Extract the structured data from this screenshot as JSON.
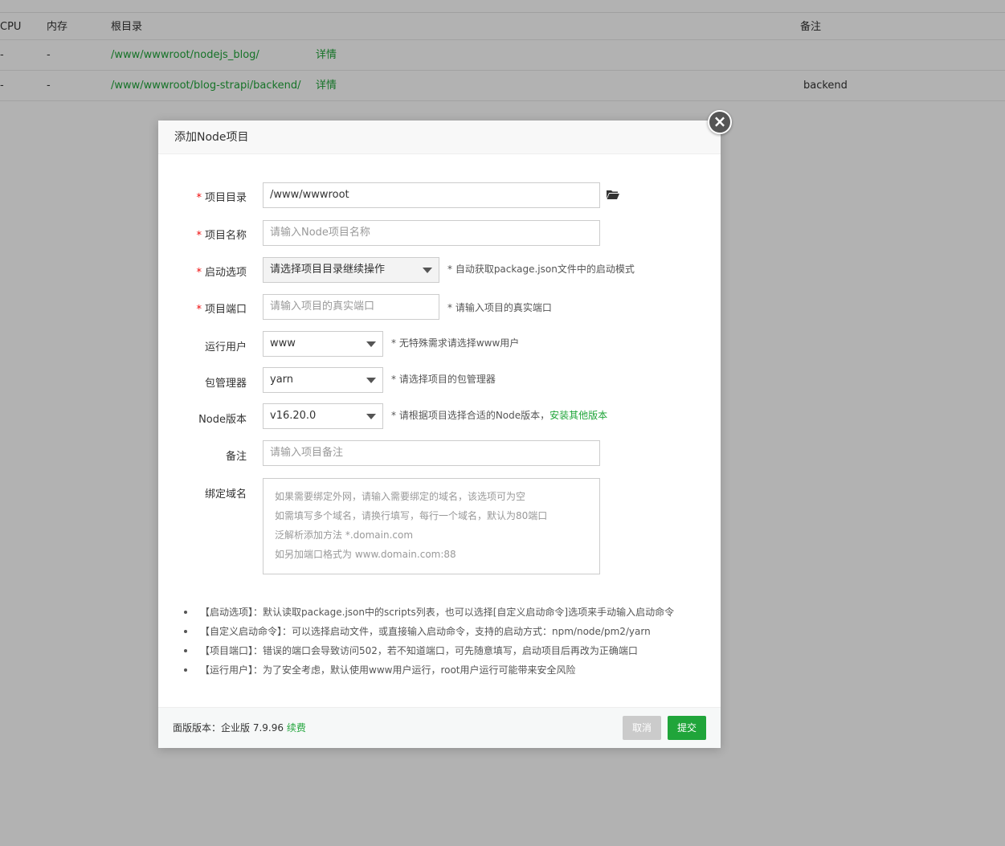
{
  "table": {
    "headers": {
      "cpu": "CPU",
      "mem": "内存",
      "root": "根目录",
      "remark": "备注"
    },
    "rows": [
      {
        "cpu": "-",
        "mem": "-",
        "path": "/www/wwwroot/nodejs_blog/",
        "detail": "详情",
        "remark": ""
      },
      {
        "cpu": "-",
        "mem": "-",
        "path": "/www/wwwroot/blog-strapi/backend/",
        "detail": "详情",
        "remark": "backend"
      }
    ]
  },
  "dialog": {
    "title": "添加Node项目",
    "close_icon": "close-icon",
    "fields": {
      "project_dir": {
        "label": "项目目录",
        "value": "/www/wwwroot",
        "required": "*"
      },
      "project_name": {
        "label": "项目名称",
        "placeholder": "请输入Node项目名称",
        "required": "*"
      },
      "start_option": {
        "label": "启动选项",
        "value": "请选择项目目录继续操作",
        "hint": "* 自动获取package.json文件中的启动模式",
        "required": "*"
      },
      "project_port": {
        "label": "项目端口",
        "placeholder": "请输入项目的真实端口",
        "hint": "* 请输入项目的真实端口",
        "required": "*"
      },
      "run_user": {
        "label": "运行用户",
        "value": "www",
        "hint": "* 无特殊需求请选择www用户"
      },
      "pkg_manager": {
        "label": "包管理器",
        "value": "yarn",
        "hint": "* 请选择项目的包管理器"
      },
      "node_version": {
        "label": "Node版本",
        "value": "v16.20.0",
        "hint": "* 请根据项目选择合适的Node版本，",
        "hint_link": "安装其他版本"
      },
      "remark": {
        "label": "备注",
        "placeholder": "请输入项目备注"
      },
      "domain": {
        "label": "绑定域名",
        "placeholder_lines": [
          "如果需要绑定外网，请输入需要绑定的域名，该选项可为空",
          "如需填写多个域名，请换行填写，每行一个域名，默认为80端口",
          "泛解析添加方法 *.domain.com",
          "如另加端口格式为 www.domain.com:88"
        ]
      }
    },
    "notes": [
      "【启动选项】：默认读取package.json中的scripts列表，也可以选择[自定义启动命令]选项来手动输入启动命令",
      "【自定义启动命令】：可以选择启动文件，或直接输入启动命令，支持的启动方式：npm/node/pm2/yarn",
      "【项目端口】：错误的端口会导致访问502，若不知道端口，可先随意填写，启动项目后再改为正确端口",
      "【运行用户】：为了安全考虑，默认使用www用户运行，root用户运行可能带来安全风险"
    ],
    "footer": {
      "version_label": "面版版本：",
      "version_value": "企业版 7.9.96",
      "renew": "续费",
      "cancel": "取消",
      "submit": "提交"
    }
  }
}
